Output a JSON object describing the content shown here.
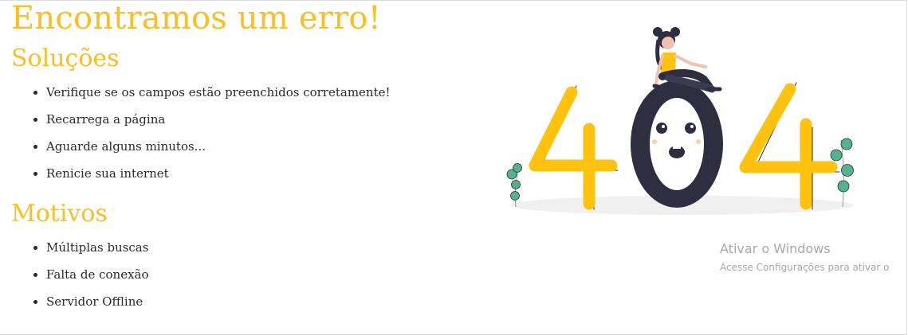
{
  "page": {
    "title": "Encontramos um erro!",
    "solutions_heading": "Soluções",
    "solutions": [
      "Verifique se os campos estão preenchidos corretamente!",
      "Recarrega a página",
      "Aguarde alguns minutos...",
      "Renicie sua internet"
    ],
    "reasons_heading": "Motivos",
    "reasons": [
      "Múltiplas buscas",
      "Falta de conexão",
      "Servidor Offline"
    ]
  },
  "illustration": {
    "icon": "404-illustration",
    "accent_color": "#ffc20e",
    "dark_color": "#2f2e41",
    "leaf_color": "#56b28c"
  },
  "watermark": {
    "title": "Ativar o Windows",
    "subtitle": "Acesse Configurações para ativar o"
  }
}
